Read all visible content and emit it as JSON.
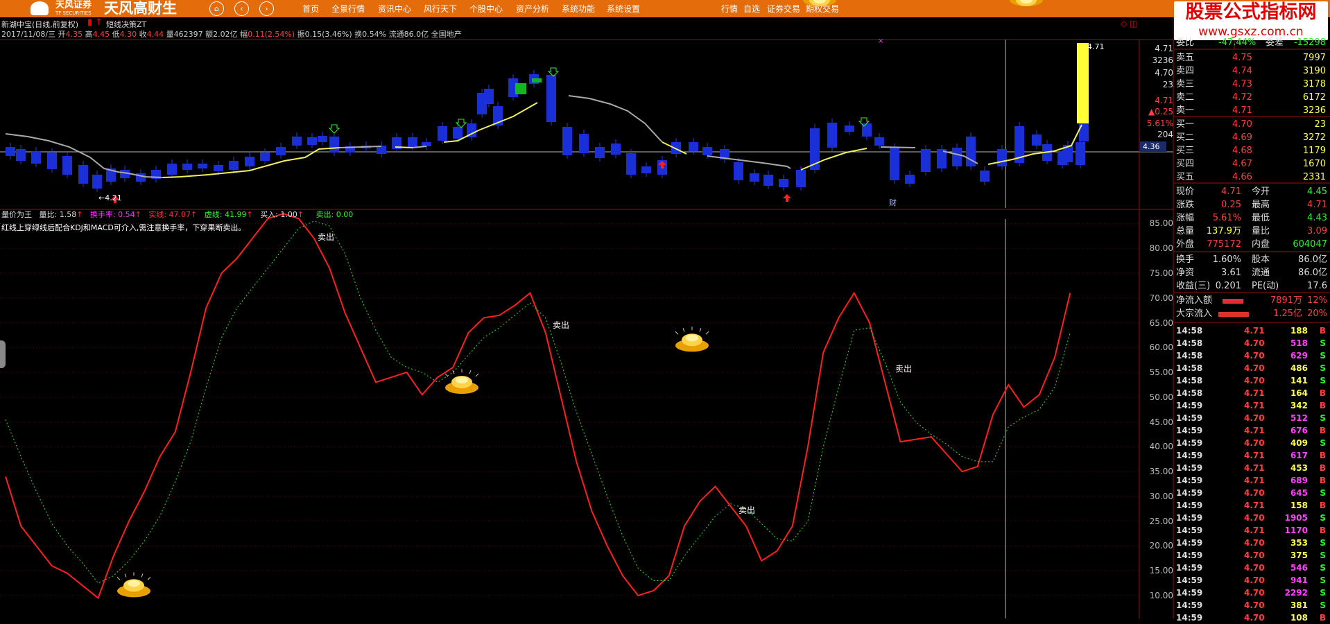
{
  "app": {
    "broker_logo": "天风证券",
    "broker_logo_sub": "TF SECURITIES",
    "app_name": "天风高财生"
  },
  "nav_buttons": [
    "⌂",
    "‹",
    "›"
  ],
  "menu": [
    "首页",
    "全景行情",
    "资讯中心",
    "风行天下",
    "个股中心",
    "资产分析",
    "系统功能",
    "系统设置",
    "行情",
    "自选",
    "证券交易",
    "期权交易"
  ],
  "watermark": {
    "title": "股票公式指标网",
    "url": "www.gsxz.com.cn"
  },
  "stock": {
    "name": "新湖中宝(日线,前复权)",
    "indicator": "短线决策ZT",
    "info_date": "2017/11/08/三",
    "open_label": "开",
    "open": "4.35",
    "high_label": "高",
    "high": "4.45",
    "low_label": "低",
    "low": "4.30",
    "close_label": "收",
    "close": "4.44",
    "vol_label": "量",
    "vol": "462397",
    "amt_label": "额",
    "amt": "2.02亿",
    "chg_label": "幅",
    "chg": "0.11(2.54%)",
    "amp_label": "振",
    "amp": "0.15(3.46%)",
    "turn_label": "换",
    "turn": "0.54%",
    "float_label": "流通",
    "float": "86.0亿",
    "sector": "全国地产"
  },
  "main_chart": {
    "price_axis": [
      "4.71",
      "3236",
      "4.70",
      "23",
      "4.71",
      "▲0.25",
      "5.61%",
      "204",
      "4.36"
    ],
    "low_marker": "←4.21",
    "high_marker": "4.71",
    "cai_label": "财"
  },
  "sub_chart": {
    "title": "量价为王",
    "legend": [
      {
        "label": "量比: 1.58",
        "color": "#dddddd"
      },
      {
        "label": "换手率: 0.54",
        "color": "#ff33ff"
      },
      {
        "label": "实线: 47.07",
        "color": "#ff3333"
      },
      {
        "label": "虚线: 41.99",
        "color": "#33ee33"
      },
      {
        "label": "买入: 1.00",
        "color": "#dddddd"
      },
      {
        "label": "卖出: 0.00",
        "color": "#33ee33"
      }
    ],
    "note": "红线上穿绿线后配合KDJ和MACD可介入,需注意换手率，下穿果断卖出。",
    "sell_label": "卖出",
    "y_ticks": [
      "85.00",
      "80.00",
      "75.00",
      "70.00",
      "65.00",
      "60.00",
      "55.00",
      "50.00",
      "45.00",
      "40.00",
      "35.00",
      "30.00",
      "25.00",
      "20.00",
      "15.00",
      "10.00"
    ]
  },
  "chart_data": {
    "type": "line",
    "series": [
      {
        "name": "实线",
        "values": [
          34,
          24,
          20,
          16,
          14.5,
          12,
          9.5,
          18,
          25,
          31,
          38,
          43,
          55,
          68,
          75,
          78,
          82,
          86,
          87,
          86,
          82,
          76,
          67,
          60,
          53,
          54,
          55,
          50.5,
          54,
          56,
          63,
          66,
          66.5,
          68.5,
          71,
          63,
          50,
          37,
          27,
          20,
          14,
          10,
          11,
          14,
          24,
          29,
          32,
          28,
          24,
          17,
          19,
          24,
          40,
          59,
          66,
          71,
          65,
          53,
          41,
          41.5,
          42,
          38.5,
          35,
          36,
          46.5,
          52.5,
          48,
          50.5,
          58,
          71
        ]
      },
      {
        "name": "虚线",
        "values": [
          45.5,
          38,
          31,
          24.5,
          20,
          16.5,
          12.5,
          14,
          17,
          21,
          26,
          33,
          41,
          52,
          62,
          68,
          72,
          76,
          80,
          84,
          85.5,
          84.5,
          79,
          70,
          63.5,
          58,
          56,
          55,
          53,
          55,
          58.5,
          62,
          64,
          66.5,
          69,
          66,
          57,
          47,
          38.5,
          30,
          22,
          15.5,
          13,
          13,
          18,
          22,
          26,
          28.5,
          27.5,
          24.5,
          21.5,
          21,
          25,
          40,
          52,
          63.5,
          64,
          57,
          49,
          45,
          42.5,
          40.5,
          38,
          37,
          37,
          44,
          46,
          47.5,
          52,
          63
        ]
      }
    ],
    "ylim": [
      10,
      88
    ]
  },
  "quote_panel": {
    "weibi_label": "委比",
    "weibi": "-47.44%",
    "weicha_label": "委差",
    "weicha": "-15298",
    "asks": [
      {
        "label": "卖五",
        "price": "4.75",
        "vol": "7997"
      },
      {
        "label": "卖四",
        "price": "4.74",
        "vol": "3190"
      },
      {
        "label": "卖三",
        "price": "4.73",
        "vol": "3178"
      },
      {
        "label": "卖二",
        "price": "4.72",
        "vol": "6172"
      },
      {
        "label": "卖一",
        "price": "4.71",
        "vol": "3236"
      }
    ],
    "bids": [
      {
        "label": "买一",
        "price": "4.70",
        "vol": "23"
      },
      {
        "label": "买二",
        "price": "4.69",
        "vol": "3272"
      },
      {
        "label": "买三",
        "price": "4.68",
        "vol": "1179"
      },
      {
        "label": "买四",
        "price": "4.67",
        "vol": "1670"
      },
      {
        "label": "买五",
        "price": "4.66",
        "vol": "2331"
      }
    ],
    "stats": [
      {
        "l1": "现价",
        "v1": "4.71",
        "c1": "#ff4040",
        "l2": "今开",
        "v2": "4.45",
        "c2": "#33ee33"
      },
      {
        "l1": "涨跌",
        "v1": "0.25",
        "c1": "#ff4040",
        "l2": "最高",
        "v2": "4.71",
        "c2": "#ff4040"
      },
      {
        "l1": "涨幅",
        "v1": "5.61%",
        "c1": "#ff4040",
        "l2": "最低",
        "v2": "4.43",
        "c2": "#33ee33"
      },
      {
        "l1": "总量",
        "v1": "137.9万",
        "c1": "#ffff55",
        "l2": "量比",
        "v2": "3.09",
        "c2": "#ff4040"
      },
      {
        "l1": "外盘",
        "v1": "775172",
        "c1": "#ff4040",
        "l2": "内盘",
        "v2": "604047",
        "c2": "#33ee33"
      },
      {
        "l1": "换手",
        "v1": "1.60%",
        "c1": "#dddddd",
        "l2": "股本",
        "v2": "86.0亿",
        "c2": "#dddddd"
      },
      {
        "l1": "净资",
        "v1": "3.61",
        "c1": "#dddddd",
        "l2": "流通",
        "v2": "86.0亿",
        "c2": "#dddddd"
      },
      {
        "l1": "收益(三)",
        "v1": "0.201",
        "c1": "#dddddd",
        "l2": "PE(动)",
        "v2": "17.6",
        "c2": "#dddddd"
      }
    ],
    "flows": [
      {
        "label": "净流入额",
        "value": "7891万",
        "pct": "12%"
      },
      {
        "label": "大宗流入",
        "value": "1.25亿",
        "pct": "20%"
      }
    ]
  },
  "ticks": [
    {
      "time": "14:58",
      "price": "4.71",
      "vol": "188",
      "side": "B",
      "vc": "#ffff55"
    },
    {
      "time": "14:58",
      "price": "4.70",
      "vol": "518",
      "side": "S",
      "vc": "#ff44ff"
    },
    {
      "time": "14:58",
      "price": "4.70",
      "vol": "629",
      "side": "S",
      "vc": "#ff44ff"
    },
    {
      "time": "14:58",
      "price": "4.70",
      "vol": "486",
      "side": "S",
      "vc": "#ffff55"
    },
    {
      "time": "14:58",
      "price": "4.70",
      "vol": "141",
      "side": "S",
      "vc": "#ffff55"
    },
    {
      "time": "14:58",
      "price": "4.71",
      "vol": "164",
      "side": "B",
      "vc": "#ffff55"
    },
    {
      "time": "14:59",
      "price": "4.71",
      "vol": "342",
      "side": "B",
      "vc": "#ffff55"
    },
    {
      "time": "14:59",
      "price": "4.70",
      "vol": "512",
      "side": "S",
      "vc": "#ff44ff"
    },
    {
      "time": "14:59",
      "price": "4.71",
      "vol": "676",
      "side": "B",
      "vc": "#ff44ff"
    },
    {
      "time": "14:59",
      "price": "4.70",
      "vol": "409",
      "side": "S",
      "vc": "#ffff55"
    },
    {
      "time": "14:59",
      "price": "4.71",
      "vol": "617",
      "side": "B",
      "vc": "#ff44ff"
    },
    {
      "time": "14:59",
      "price": "4.71",
      "vol": "453",
      "side": "B",
      "vc": "#ffff55"
    },
    {
      "time": "14:59",
      "price": "4.71",
      "vol": "689",
      "side": "B",
      "vc": "#ff44ff"
    },
    {
      "time": "14:59",
      "price": "4.70",
      "vol": "645",
      "side": "S",
      "vc": "#ff44ff"
    },
    {
      "time": "14:59",
      "price": "4.71",
      "vol": "158",
      "side": "B",
      "vc": "#ffff55"
    },
    {
      "time": "14:59",
      "price": "4.70",
      "vol": "1905",
      "side": "S",
      "vc": "#ff44ff"
    },
    {
      "time": "14:59",
      "price": "4.71",
      "vol": "1170",
      "side": "B",
      "vc": "#ff44ff"
    },
    {
      "time": "14:59",
      "price": "4.70",
      "vol": "353",
      "side": "S",
      "vc": "#ffff55"
    },
    {
      "time": "14:59",
      "price": "4.70",
      "vol": "375",
      "side": "S",
      "vc": "#ffff55"
    },
    {
      "time": "14:59",
      "price": "4.70",
      "vol": "546",
      "side": "S",
      "vc": "#ff44ff"
    },
    {
      "time": "14:59",
      "price": "4.70",
      "vol": "941",
      "side": "S",
      "vc": "#ff44ff"
    },
    {
      "time": "14:59",
      "price": "4.70",
      "vol": "2292",
      "side": "S",
      "vc": "#ff44ff"
    },
    {
      "time": "14:59",
      "price": "4.70",
      "vol": "381",
      "side": "S",
      "vc": "#ffff55"
    },
    {
      "time": "14:59",
      "price": "4.70",
      "vol": "108",
      "side": "B",
      "vc": "#ffff55"
    }
  ]
}
